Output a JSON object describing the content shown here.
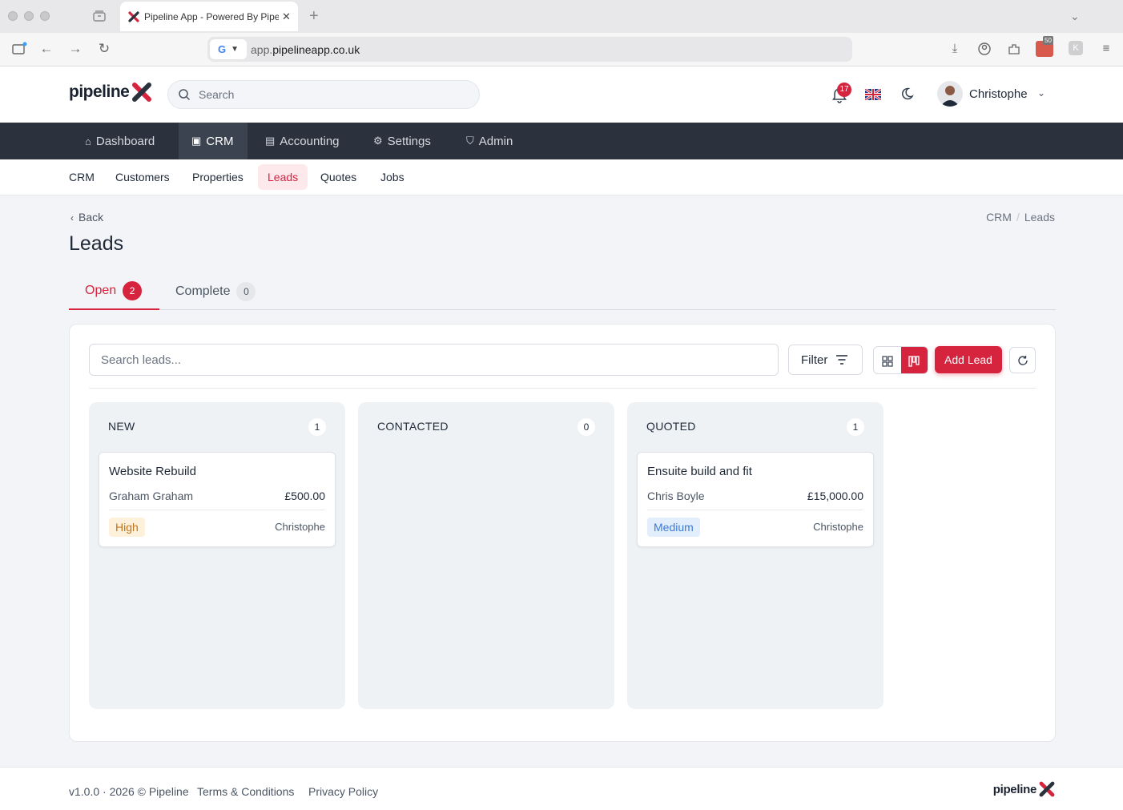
{
  "browser": {
    "tab_title": "Pipeline App - Powered By Pipeline",
    "url_subdomain": "app.",
    "url_domain": "pipelineapp.co.uk",
    "ext_badge": "50"
  },
  "header": {
    "brand": "pipeline",
    "search_placeholder": "Search",
    "notifications_count": "17",
    "user_name": "Christophe"
  },
  "main_nav": {
    "items": [
      {
        "label": "Dashboard",
        "icon": "home-icon"
      },
      {
        "label": "CRM",
        "icon": "crm-icon"
      },
      {
        "label": "Accounting",
        "icon": "calculator-icon"
      },
      {
        "label": "Settings",
        "icon": "gear-icon"
      },
      {
        "label": "Admin",
        "icon": "shield-icon"
      }
    ],
    "active": "CRM"
  },
  "sub_nav": {
    "items": [
      "CRM",
      "Customers",
      "Properties",
      "Leads",
      "Quotes",
      "Jobs"
    ],
    "active": "Leads"
  },
  "page": {
    "back_label": "Back",
    "breadcrumb": [
      "CRM",
      "Leads"
    ],
    "title": "Leads"
  },
  "tabs": [
    {
      "label": "Open",
      "count": "2"
    },
    {
      "label": "Complete",
      "count": "0"
    }
  ],
  "toolbar": {
    "search_placeholder": "Search leads...",
    "filter_label": "Filter",
    "add_label": "Add Lead"
  },
  "columns": [
    {
      "title": "NEW",
      "count": "1",
      "cards": [
        {
          "title": "Website Rebuild",
          "customer": "Graham Graham",
          "value": "£500.00",
          "priority": "High",
          "owner": "Christophe"
        }
      ]
    },
    {
      "title": "CONTACTED",
      "count": "0",
      "cards": []
    },
    {
      "title": "QUOTED",
      "count": "1",
      "cards": [
        {
          "title": "Ensuite build and fit",
          "customer": "Chris Boyle",
          "value": "£15,000.00",
          "priority": "Medium",
          "owner": "Christophe"
        }
      ]
    }
  ],
  "footer": {
    "copyright": "v1.0.0 · 2026 © Pipeline",
    "terms": "Terms & Conditions",
    "privacy": "Privacy Policy",
    "brand": "pipeline"
  },
  "colors": {
    "accent": "#d6243f",
    "nav_bg": "#2b323d",
    "high_priority": "#c2731b",
    "medium_priority": "#3b7bd6"
  }
}
